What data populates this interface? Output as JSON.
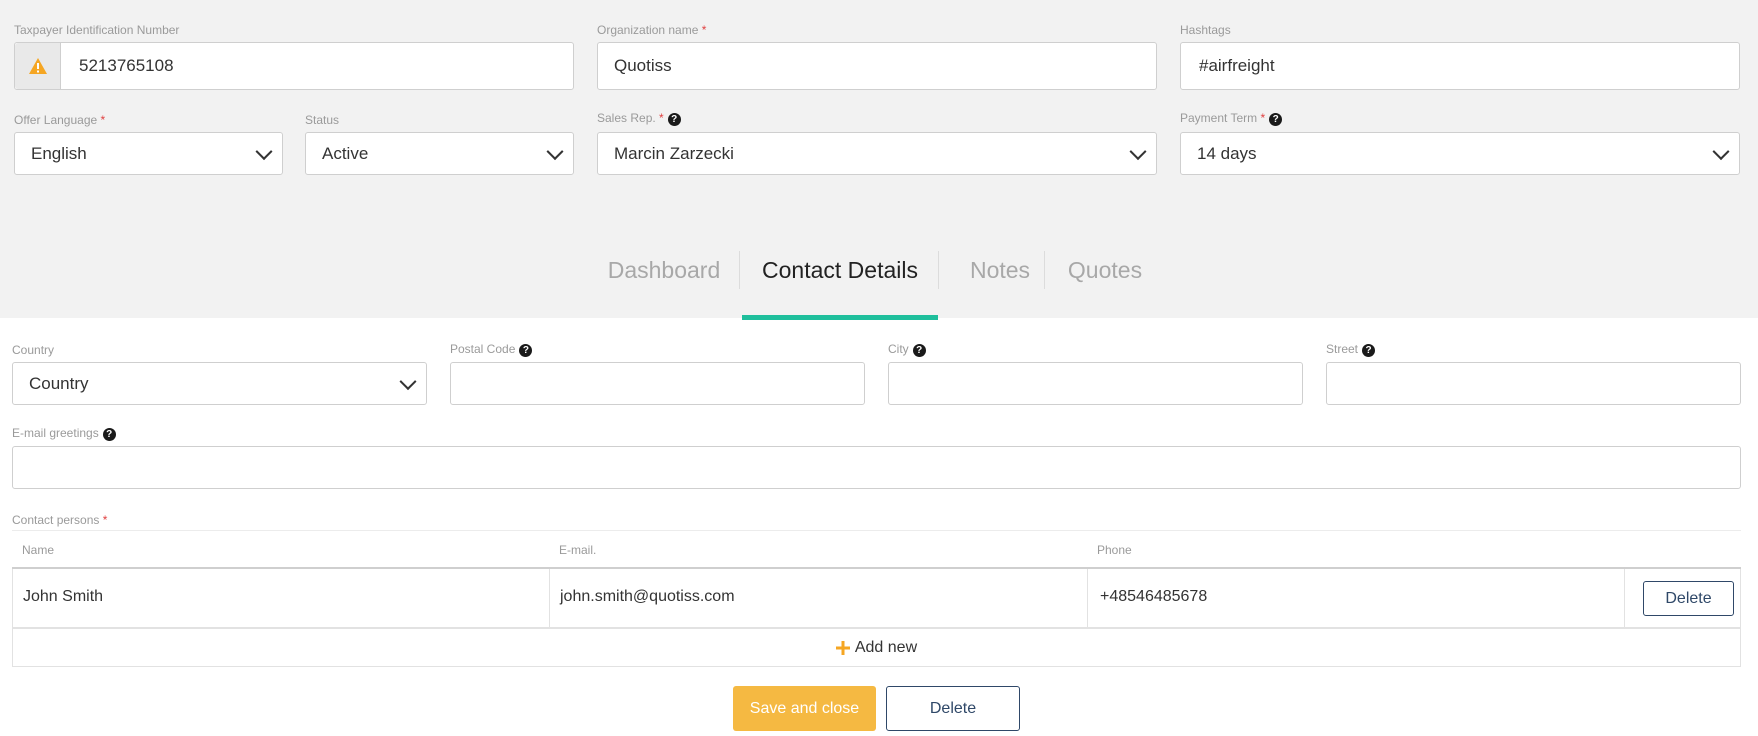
{
  "form": {
    "taxpayer": {
      "label": "Taxpayer Identification Number",
      "value": "5213765108"
    },
    "organization": {
      "label": "Organization name",
      "required": "*",
      "value": "Quotiss"
    },
    "hashtags": {
      "label": "Hashtags",
      "value": "#airfreight"
    },
    "offer_language": {
      "label": "Offer Language",
      "required": "*",
      "value": "English"
    },
    "status": {
      "label": "Status",
      "value": "Active"
    },
    "sales_rep": {
      "label": "Sales Rep.",
      "required": "*",
      "value": "Marcin Zarzecki"
    },
    "payment_term": {
      "label": "Payment Term",
      "required": "*",
      "value": "14 days"
    }
  },
  "tabs": [
    {
      "label": "Dashboard"
    },
    {
      "label": "Contact Details"
    },
    {
      "label": "Notes"
    },
    {
      "label": "Quotes"
    }
  ],
  "contact": {
    "country": {
      "label": "Country",
      "value": "Country"
    },
    "postal_code": {
      "label": "Postal Code",
      "value": ""
    },
    "city": {
      "label": "City",
      "value": ""
    },
    "street": {
      "label": "Street",
      "value": ""
    },
    "email_greetings": {
      "label": "E-mail greetings",
      "value": ""
    },
    "contact_persons_label": "Contact persons",
    "required": "*"
  },
  "table": {
    "headers": [
      "Name",
      "E-mail.",
      "Phone"
    ],
    "rows": [
      {
        "name": "John Smith",
        "email": "john.smith@quotiss.com",
        "phone": "+48546485678",
        "delete_label": "Delete"
      }
    ],
    "add_new_label": "Add new"
  },
  "actions": {
    "save_label": "Save and close",
    "delete_label": "Delete"
  },
  "colors": {
    "accent_tab": "#1fbf9c",
    "save_button": "#f5b942",
    "warning": "#f5a623",
    "outline_button": "#2f4868"
  }
}
